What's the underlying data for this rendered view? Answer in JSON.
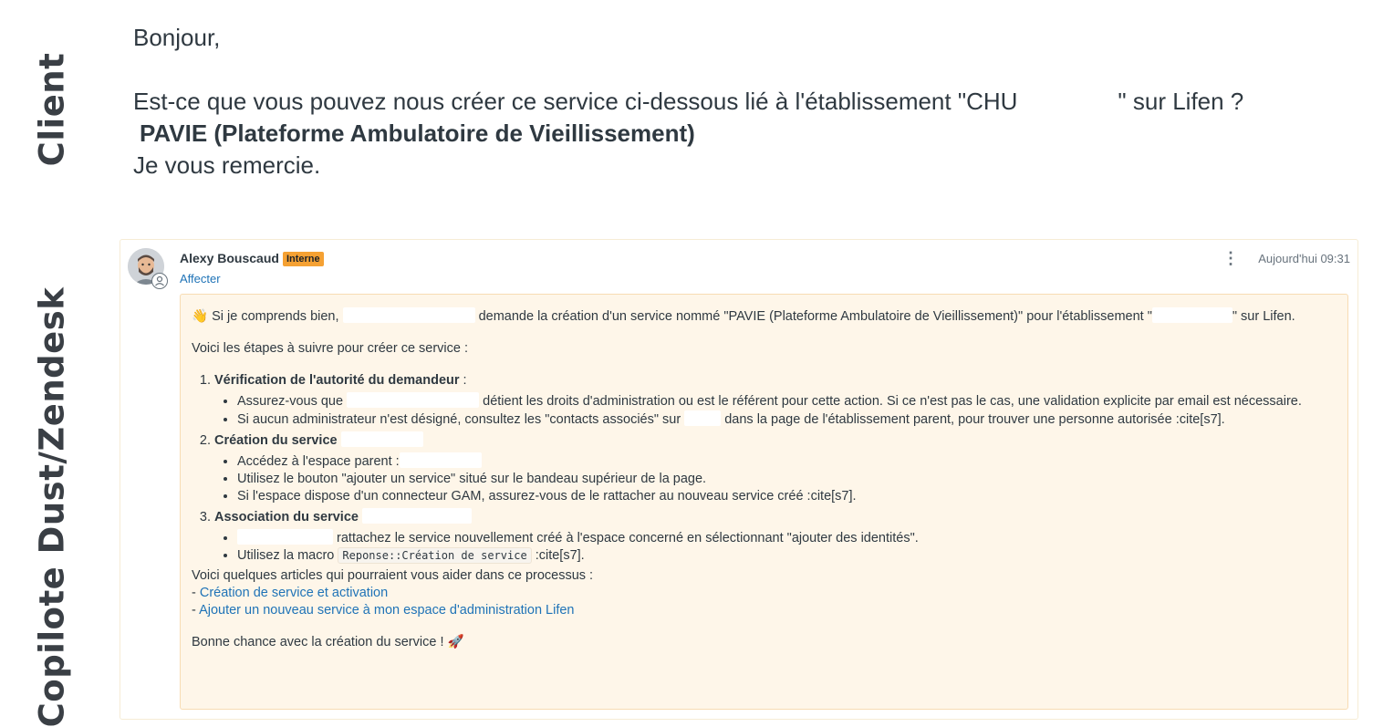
{
  "labels": {
    "client": "Client",
    "copilot": "Copilote Dust/Zendesk"
  },
  "client": {
    "greeting": "Bonjour,",
    "request_start": "Est-ce que vous pouvez nous créer ce service ci-dessous lié à l'établissement \"CHU",
    "request_end": "\" sur Lifen ?",
    "service_name": "PAVIE (Plateforme Ambulatoire de Vieillissement)",
    "thanks": "Je vous remercie."
  },
  "ticket": {
    "author": "Alexy Bouscaud",
    "badge": "Interne",
    "assign_link": "Affecter",
    "timestamp": "Aujourd'hui 09:31",
    "menu_icon": "vertical-dots-icon",
    "body": {
      "intro_a": "👋 Si je comprends bien,",
      "intro_b": "demande la création d'un service nommé \"PAVIE (Plateforme Ambulatoire de Vieillissement)\" pour l'établissement \"",
      "intro_c": "\" sur Lifen.",
      "steps_intro": "Voici les étapes à suivre pour créer ce service :",
      "step1_title": "Vérification de l'autorité du demandeur",
      "step1_colon": " :",
      "step1_b1_a": "Assurez-vous que",
      "step1_b1_b": "détient les droits d'administration ou est le référent pour cette action. Si ce n'est pas le cas, une validation explicite par email est nécessaire.",
      "step1_b2_a": "Si aucun administrateur n'est désigné, consultez les \"contacts associés\" sur",
      "step1_b2_b": "dans la page de l'établissement parent, pour trouver une personne autorisée :cite[s7].",
      "step2_title": "Création du service",
      "step2_b1": "Accédez à l'espace parent :",
      "step2_b2": "Utilisez le bouton \"ajouter un service\" situé sur le bandeau supérieur de la page.",
      "step2_b3": "Si l'espace dispose d'un connecteur GAM, assurez-vous de le rattacher au nouveau service créé :cite[s7].",
      "step3_title": "Association du service",
      "step3_b1": "rattachez le service nouvellement créé à l'espace concerné en sélectionnant \"ajouter des identités\".",
      "step3_b2_a": "Utilisez la macro",
      "step3_b2_code": "Reponse::Création de service",
      "step3_b2_b": ":cite[s7].",
      "articles_intro": "Voici quelques articles qui pourraient vous aider dans ce processus :",
      "dash": "- ",
      "article1": "Création de service et activation",
      "article2": "Ajouter un nouveau service à mon espace d'administration Lifen",
      "closing": "Bonne chance avec la création du service ! 🚀"
    }
  },
  "colors": {
    "accent_link": "#1f73b7",
    "badge_bg": "#f5a133",
    "bubble_bg": "#fef6e9"
  }
}
